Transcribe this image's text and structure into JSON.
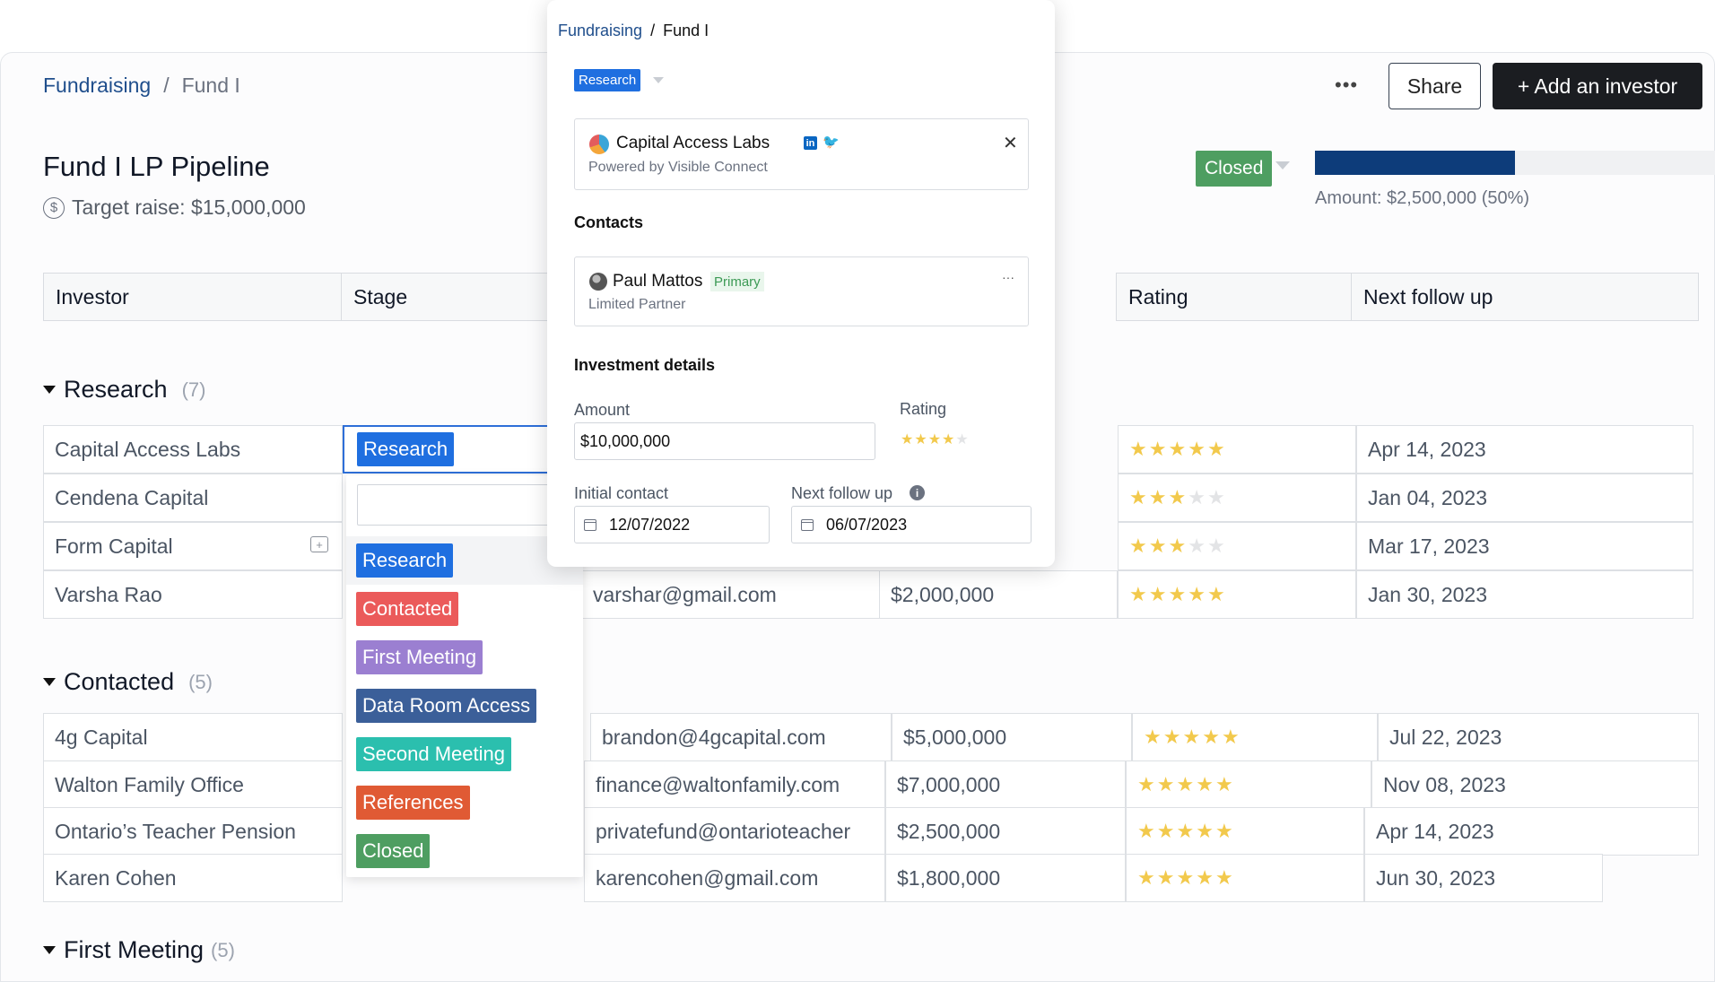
{
  "breadcrumb": {
    "parent": "Fundraising",
    "separator": "/",
    "current": "Fund I"
  },
  "page": {
    "title": "Fund I LP Pipeline",
    "target_raise": "Target raise: $15,000,000"
  },
  "toolbar": {
    "more": "•••",
    "share": "Share",
    "add_investor": "+ Add an investor"
  },
  "status": {
    "label": "Closed",
    "color": "#4e9e61",
    "progress_fraction": 0.5,
    "amount_text": "Amount: $2,500,000 (50%)"
  },
  "columns": {
    "investor": "Investor",
    "stage": "Stage",
    "rating": "Rating",
    "next_follow_up": "Next follow up"
  },
  "groups": {
    "research": {
      "title": "Research",
      "count": "(7)",
      "rows": [
        {
          "investor": "Capital Access Labs",
          "rating": 5,
          "follow_up": "Apr 14, 2023"
        },
        {
          "investor": "Cendena Capital",
          "rating": 3,
          "follow_up": "Jan 04, 2023"
        },
        {
          "investor": "Form Capital",
          "rating": 3,
          "follow_up": "Mar 17, 2023"
        },
        {
          "investor": "Varsha Rao",
          "email": "varshar@gmail.com",
          "amount": "$2,000,000",
          "rating": 5,
          "follow_up": "Jan 30, 2023"
        }
      ]
    },
    "contacted": {
      "title": "Contacted",
      "count": "(5)",
      "rows": [
        {
          "investor": "4g Capital",
          "email": "brandon@4gcapital.com",
          "amount": "$5,000,000",
          "rating": 5,
          "follow_up": "Jul 22, 2023"
        },
        {
          "investor": "Walton Family Office",
          "email": "finance@waltonfamily.com",
          "amount": "$7,000,000",
          "rating": 5,
          "follow_up": "Nov 08, 2023"
        },
        {
          "investor": "Ontario’s Teacher Pension",
          "email": "privatefund@ontarioteacher",
          "amount": "$2,500,000",
          "rating": 5,
          "follow_up": "Apr 14, 2023"
        },
        {
          "investor": "Karen Cohen",
          "email": "karencohen@gmail.com",
          "amount": "$1,800,000",
          "rating": 5,
          "follow_up": "Jun 30, 2023"
        }
      ]
    },
    "first_meeting": {
      "title": "First Meeting",
      "count": "(5)"
    }
  },
  "stage_editor": {
    "current": {
      "label": "Research",
      "color": "#1f6fe0"
    },
    "options": [
      {
        "label": "Research",
        "color": "#1f6fe0"
      },
      {
        "label": "Contacted",
        "color": "#eb5a5a"
      },
      {
        "label": "First Meeting",
        "color": "#9b7fd1"
      },
      {
        "label": "Data Room Access",
        "color": "#3b5f99"
      },
      {
        "label": "Second Meeting",
        "color": "#2bbfae"
      },
      {
        "label": "References",
        "color": "#e05a34"
      },
      {
        "label": "Closed",
        "color": "#4e9e61"
      }
    ]
  },
  "popover": {
    "breadcrumb": {
      "parent": "Fundraising",
      "separator": "/",
      "current": "Fund I"
    },
    "stage_tag": "Research",
    "company": {
      "name": "Capital Access Labs",
      "powered_by": "Powered by Visible Connect",
      "linkedin": "in",
      "twitter": "🐦"
    },
    "contacts_label": "Contacts",
    "contact": {
      "name": "Paul Mattos",
      "badge": "Primary",
      "role": "Limited Partner",
      "more": "···"
    },
    "investment_label": "Investment details",
    "amount_label": "Amount",
    "amount_value": "$10,000,000",
    "rating_label": "Rating",
    "rating": 4,
    "initial_contact_label": "Initial contact",
    "initial_contact_value": "12/07/2022",
    "next_follow_up_label": "Next follow up",
    "next_follow_up_value": "06/07/2023",
    "close": "✕"
  }
}
